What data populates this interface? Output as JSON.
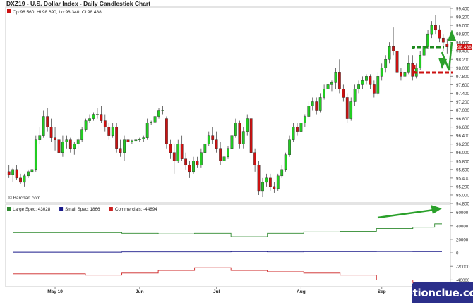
{
  "chart_data": [
    {
      "type": "candlestick",
      "title": "DXZ19 - U.S. Dollar Index - Daily Candlestick Chart",
      "ohlc_label": "Op:98.560, Hi:98.690, Lo:98.340, Cl:98.488",
      "last_price_label": "98.488",
      "last_price": 98.488,
      "watermark": "© Barchart.com",
      "ylim": [
        94.8,
        99.4
      ],
      "y_ticks": [
        "99.400",
        "99.200",
        "99.000",
        "98.800",
        "98.600",
        "98.400",
        "98.200",
        "98.000",
        "97.800",
        "97.600",
        "97.400",
        "97.200",
        "97.000",
        "96.800",
        "96.600",
        "96.400",
        "96.200",
        "96.000",
        "95.800",
        "95.600",
        "95.400",
        "95.200",
        "95.000",
        "94.800"
      ],
      "x_labels": [
        "May 19",
        "Jun",
        "Jul",
        "Aug",
        "Sep"
      ],
      "x_label_index": [
        12,
        34,
        54,
        76,
        97
      ],
      "colors": {
        "up": "#22cc22",
        "down": "#cc1111"
      },
      "candles": [
        [
          95.55,
          95.7,
          95.4,
          95.48
        ],
        [
          95.48,
          95.65,
          95.3,
          95.6
        ],
        [
          95.6,
          95.7,
          95.35,
          95.4
        ],
        [
          95.4,
          95.5,
          95.25,
          95.3
        ],
        [
          95.3,
          95.5,
          95.2,
          95.45
        ],
        [
          95.45,
          95.6,
          95.4,
          95.55
        ],
        [
          95.55,
          95.7,
          95.5,
          95.6
        ],
        [
          95.6,
          96.4,
          95.55,
          96.3
        ],
        [
          96.3,
          96.6,
          96.2,
          96.4
        ],
        [
          96.4,
          97.0,
          96.35,
          96.85
        ],
        [
          96.85,
          97.05,
          96.5,
          96.6
        ],
        [
          96.6,
          96.8,
          96.25,
          96.35
        ],
        [
          96.35,
          96.6,
          96.05,
          96.3
        ],
        [
          96.3,
          96.5,
          95.9,
          96.0
        ],
        [
          96.0,
          96.4,
          95.9,
          96.25
        ],
        [
          96.25,
          96.4,
          96.1,
          96.3
        ],
        [
          96.3,
          96.35,
          96.0,
          96.1
        ],
        [
          96.1,
          96.25,
          95.95,
          96.2
        ],
        [
          96.2,
          96.35,
          96.1,
          96.3
        ],
        [
          96.3,
          96.6,
          96.25,
          96.55
        ],
        [
          96.55,
          96.8,
          96.5,
          96.75
        ],
        [
          96.75,
          96.9,
          96.7,
          96.8
        ],
        [
          96.8,
          96.95,
          96.75,
          96.9
        ],
        [
          96.9,
          97.05,
          96.8,
          96.9
        ],
        [
          96.9,
          97.1,
          96.7,
          96.75
        ],
        [
          96.75,
          96.9,
          96.5,
          96.6
        ],
        [
          96.6,
          96.7,
          96.3,
          96.4
        ],
        [
          96.4,
          96.7,
          96.35,
          96.6
        ],
        [
          96.6,
          96.7,
          96.0,
          96.1
        ],
        [
          96.1,
          96.3,
          95.9,
          96.0
        ],
        [
          96.0,
          96.4,
          95.8,
          96.3
        ],
        [
          96.3,
          96.35,
          96.2,
          96.25
        ],
        [
          96.25,
          96.3,
          96.2,
          96.28
        ],
        [
          96.28,
          96.35,
          96.2,
          96.3
        ],
        [
          96.3,
          96.35,
          96.25,
          96.32
        ],
        [
          96.32,
          96.4,
          96.25,
          96.35
        ],
        [
          96.35,
          96.8,
          96.3,
          96.7
        ],
        [
          96.7,
          96.75,
          96.65,
          96.72
        ],
        [
          96.72,
          96.9,
          96.7,
          96.85
        ],
        [
          96.85,
          97.05,
          96.8,
          97.0
        ],
        [
          97.0,
          97.1,
          96.9,
          97.0
        ],
        [
          96.8,
          96.85,
          96.1,
          96.2
        ],
        [
          96.2,
          96.3,
          95.85,
          96.0
        ],
        [
          96.0,
          96.2,
          95.5,
          95.8
        ],
        [
          95.8,
          96.3,
          95.75,
          96.2
        ],
        [
          96.2,
          96.4,
          95.8,
          95.85
        ],
        [
          95.85,
          96.0,
          95.6,
          95.7
        ],
        [
          95.7,
          95.8,
          95.4,
          95.55
        ],
        [
          95.55,
          95.9,
          95.5,
          95.8
        ],
        [
          95.8,
          95.9,
          95.65,
          95.7
        ],
        [
          95.7,
          96.1,
          95.65,
          96.0
        ],
        [
          96.0,
          96.3,
          95.95,
          96.2
        ],
        [
          96.2,
          96.5,
          96.15,
          96.4
        ],
        [
          96.4,
          96.6,
          96.2,
          96.3
        ],
        [
          96.3,
          96.5,
          96.0,
          96.1
        ],
        [
          96.1,
          96.25,
          95.7,
          95.8
        ],
        [
          95.8,
          96.0,
          95.6,
          95.9
        ],
        [
          95.9,
          96.15,
          95.85,
          96.1
        ],
        [
          96.1,
          96.5,
          96.0,
          96.4
        ],
        [
          96.4,
          96.8,
          96.35,
          96.7
        ],
        [
          96.7,
          96.75,
          96.1,
          96.2
        ],
        [
          96.2,
          96.6,
          96.1,
          96.5
        ],
        [
          96.5,
          96.9,
          96.4,
          96.8
        ],
        [
          96.8,
          96.85,
          95.9,
          96.0
        ],
        [
          96.0,
          96.1,
          95.55,
          95.7
        ],
        [
          95.7,
          95.8,
          95.0,
          95.1
        ],
        [
          95.1,
          95.4,
          94.95,
          95.3
        ],
        [
          95.3,
          95.5,
          95.2,
          95.4
        ],
        [
          95.4,
          95.5,
          95.1,
          95.2
        ],
        [
          95.2,
          95.3,
          95.05,
          95.15
        ],
        [
          95.15,
          95.5,
          95.1,
          95.45
        ],
        [
          95.45,
          95.7,
          95.4,
          95.6
        ],
        [
          95.6,
          96.0,
          95.55,
          95.95
        ],
        [
          95.95,
          96.4,
          95.9,
          96.3
        ],
        [
          96.3,
          96.7,
          96.25,
          96.6
        ],
        [
          96.6,
          96.7,
          96.4,
          96.5
        ],
        [
          96.5,
          96.8,
          96.45,
          96.7
        ],
        [
          96.7,
          96.9,
          96.6,
          96.85
        ],
        [
          96.85,
          97.2,
          96.8,
          97.1
        ],
        [
          97.1,
          97.3,
          97.0,
          97.2
        ],
        [
          97.2,
          97.3,
          96.9,
          97.0
        ],
        [
          97.0,
          97.4,
          96.95,
          97.3
        ],
        [
          97.3,
          97.6,
          97.25,
          97.5
        ],
        [
          97.5,
          97.7,
          97.4,
          97.6
        ],
        [
          97.6,
          97.7,
          97.45,
          97.65
        ],
        [
          97.65,
          98.0,
          97.5,
          97.9
        ],
        [
          97.9,
          98.2,
          97.4,
          97.5
        ],
        [
          97.5,
          97.6,
          97.2,
          97.3
        ],
        [
          97.3,
          97.4,
          96.7,
          96.8
        ],
        [
          96.8,
          97.3,
          96.75,
          97.2
        ],
        [
          97.2,
          97.6,
          97.1,
          97.5
        ],
        [
          97.5,
          97.7,
          97.4,
          97.6
        ],
        [
          97.6,
          97.8,
          97.5,
          97.7
        ],
        [
          97.7,
          97.85,
          97.6,
          97.8
        ],
        [
          97.8,
          97.85,
          97.5,
          97.6
        ],
        [
          97.6,
          97.7,
          97.3,
          97.4
        ],
        [
          97.4,
          97.9,
          97.35,
          97.8
        ],
        [
          97.8,
          98.1,
          97.7,
          98.0
        ],
        [
          98.0,
          98.3,
          97.9,
          98.2
        ],
        [
          98.2,
          98.6,
          98.1,
          98.5
        ],
        [
          98.5,
          98.95,
          98.3,
          98.4
        ],
        [
          98.4,
          98.45,
          97.8,
          97.9
        ],
        [
          97.9,
          98.0,
          97.7,
          97.8
        ],
        [
          97.8,
          97.95,
          97.7,
          97.9
        ],
        [
          97.9,
          98.3,
          97.85,
          98.1
        ],
        [
          98.1,
          98.3,
          97.7,
          97.8
        ],
        [
          97.8,
          98.1,
          97.75,
          98.0
        ],
        [
          98.0,
          98.4,
          97.95,
          98.3
        ],
        [
          98.3,
          98.6,
          98.2,
          98.5
        ],
        [
          98.5,
          98.9,
          98.45,
          98.8
        ],
        [
          98.8,
          99.1,
          98.7,
          99.0
        ],
        [
          99.0,
          99.25,
          98.8,
          98.9
        ],
        [
          98.9,
          99.0,
          98.6,
          98.7
        ],
        [
          98.7,
          98.8,
          98.4,
          98.6
        ],
        [
          98.56,
          98.69,
          98.34,
          98.49
        ]
      ]
    },
    {
      "type": "line",
      "legend": [
        {
          "name": "Large Spec: 43028",
          "color": "#2f8a2f"
        },
        {
          "name": "Small Spec: 1866",
          "color": "#1a1a8a"
        },
        {
          "name": "Commercials: -44894",
          "color": "#cc2020"
        }
      ],
      "ylim": [
        -50000,
        70000
      ],
      "y_ticks": [
        "60000",
        "40000",
        "20000",
        "0",
        "-20000",
        "-40000"
      ],
      "series": [
        {
          "name": "Large Spec",
          "color": "#2f8a2f",
          "values": [
            30000,
            30000,
            30000,
            30000,
            30000,
            30000,
            30000,
            30000,
            30000,
            30000,
            30000,
            30000,
            30000,
            30000,
            30000,
            29000,
            29000,
            29000,
            29000,
            29000,
            28000,
            28000,
            28000,
            28000,
            28000,
            29000,
            29000,
            29000,
            29000,
            29000,
            24000,
            24000,
            24000,
            24000,
            24000,
            29000,
            29000,
            29000,
            29000,
            29000,
            31000,
            31000,
            31000,
            31000,
            31000,
            32000,
            32000,
            32000,
            32000,
            32000,
            36000,
            36000,
            36000,
            36000,
            36000,
            38000,
            38000,
            38000,
            43000,
            43000
          ]
        },
        {
          "name": "Small Spec",
          "color": "#1a1a8a",
          "values": [
            1000,
            1000,
            1000,
            1000,
            1000,
            1000,
            1000,
            1000,
            1000,
            1000,
            1000,
            1000,
            1000,
            1000,
            1000,
            1500,
            1500,
            1500,
            1500,
            1500,
            1500,
            1500,
            1500,
            1500,
            1500,
            1500,
            1500,
            1500,
            1500,
            1500,
            1800,
            1800,
            1800,
            1800,
            1800,
            1500,
            1500,
            1500,
            1500,
            1500,
            1800,
            1800,
            1800,
            1800,
            1800,
            1800,
            1800,
            1800,
            1800,
            1800,
            2000,
            2000,
            2000,
            2000,
            2000,
            1900,
            1900,
            1900,
            1866,
            1866
          ]
        },
        {
          "name": "Commercials",
          "color": "#cc2020",
          "values": [
            -31000,
            -31000,
            -31000,
            -31000,
            -31000,
            -31000,
            -31000,
            -31000,
            -31000,
            -31000,
            -33000,
            -33000,
            -33000,
            -33000,
            -33000,
            -30000,
            -30000,
            -30000,
            -30000,
            -30000,
            -26000,
            -26000,
            -26000,
            -26000,
            -26000,
            -22000,
            -22000,
            -22000,
            -22000,
            -22000,
            -26000,
            -26000,
            -26000,
            -26000,
            -26000,
            -28000,
            -28000,
            -28000,
            -28000,
            -28000,
            -30000,
            -30000,
            -30000,
            -30000,
            -30000,
            -33000,
            -33000,
            -33000,
            -33000,
            -33000,
            -40000,
            -40000,
            -40000,
            -40000,
            -40000,
            -44000,
            -44000,
            -44000,
            -44894,
            -44894
          ]
        }
      ]
    }
  ],
  "brand": "optionclue.com"
}
